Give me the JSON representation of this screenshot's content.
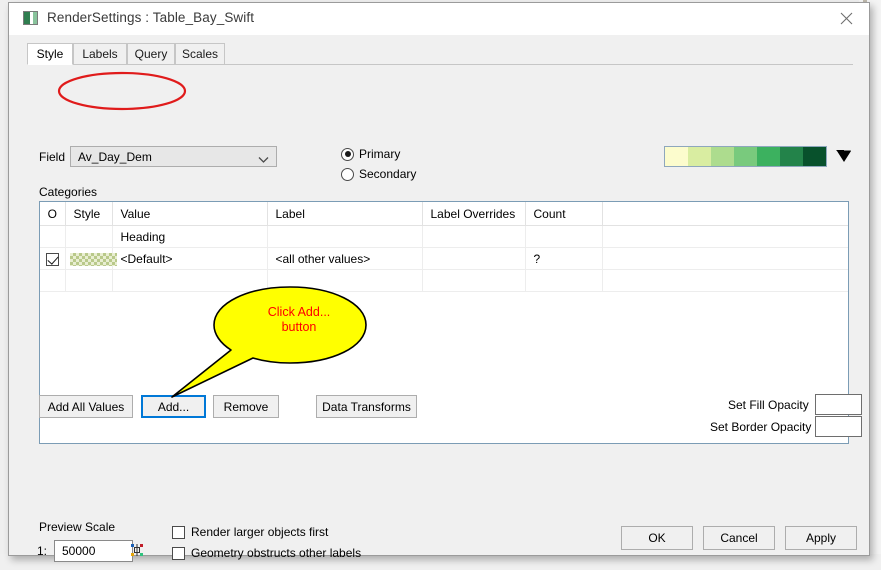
{
  "window": {
    "title": "RenderSettings : Table_Bay_Swift",
    "icon": "window-thumbnail-icon",
    "close_label": "×"
  },
  "tabs": [
    {
      "label": "Style",
      "active": true
    },
    {
      "label": "Labels",
      "active": false
    },
    {
      "label": "Query",
      "active": false
    },
    {
      "label": "Scales",
      "active": false
    }
  ],
  "field_row": {
    "label": "Field",
    "value": "Av_Day_Dem",
    "dropdown_icon": "chevron-down-icon"
  },
  "target": {
    "options": [
      {
        "label": "Primary",
        "selected": true
      },
      {
        "label": "Secondary",
        "selected": false
      }
    ]
  },
  "color_ramp": {
    "colors": [
      "#fcfccd",
      "#d9eda1",
      "#addc8e",
      "#79ca7d",
      "#3cb15f",
      "#23834a",
      "#08512c"
    ],
    "expand_icon": "ramp-dropdown-icon"
  },
  "categories": {
    "label": "Categories",
    "columns": [
      "O",
      "Style",
      "Value",
      "Label",
      "Label Overrides",
      "Count"
    ],
    "rows": [
      {
        "checked": null,
        "style": null,
        "value": "Heading",
        "label": "",
        "label_overrides": "",
        "count": ""
      },
      {
        "checked": true,
        "style": "checkered-green-swatch",
        "value": "<Default>",
        "label": "<all other values>",
        "label_overrides": "",
        "count": "?"
      }
    ]
  },
  "action_buttons": [
    {
      "label": "Add All Values",
      "focused": false
    },
    {
      "label": "Add...",
      "focused": true
    },
    {
      "label": "Remove",
      "focused": false
    },
    {
      "label": "Data Transforms",
      "focused": false
    }
  ],
  "opacity": {
    "fill_label": "Set Fill Opacity",
    "fill_value": "",
    "border_label": "Set Border Opacity",
    "border_value": ""
  },
  "preview_scale": {
    "title": "Preview Scale",
    "prefix": "1:",
    "value": "50000",
    "picker_icon": "scale-picker-icon"
  },
  "render_options": [
    {
      "label": "Render larger objects first",
      "checked": false
    },
    {
      "label": "Geometry obstructs other labels",
      "checked": false
    }
  ],
  "footer_buttons": [
    {
      "label": "OK"
    },
    {
      "label": "Cancel"
    },
    {
      "label": "Apply"
    }
  ],
  "annotations": {
    "callout_text_line1": "Click Add...",
    "callout_text_line2": "button",
    "callout_fill": "#ffff00",
    "callout_stroke": "#000000",
    "highlight_ellipse_color": "#e01b1b"
  }
}
